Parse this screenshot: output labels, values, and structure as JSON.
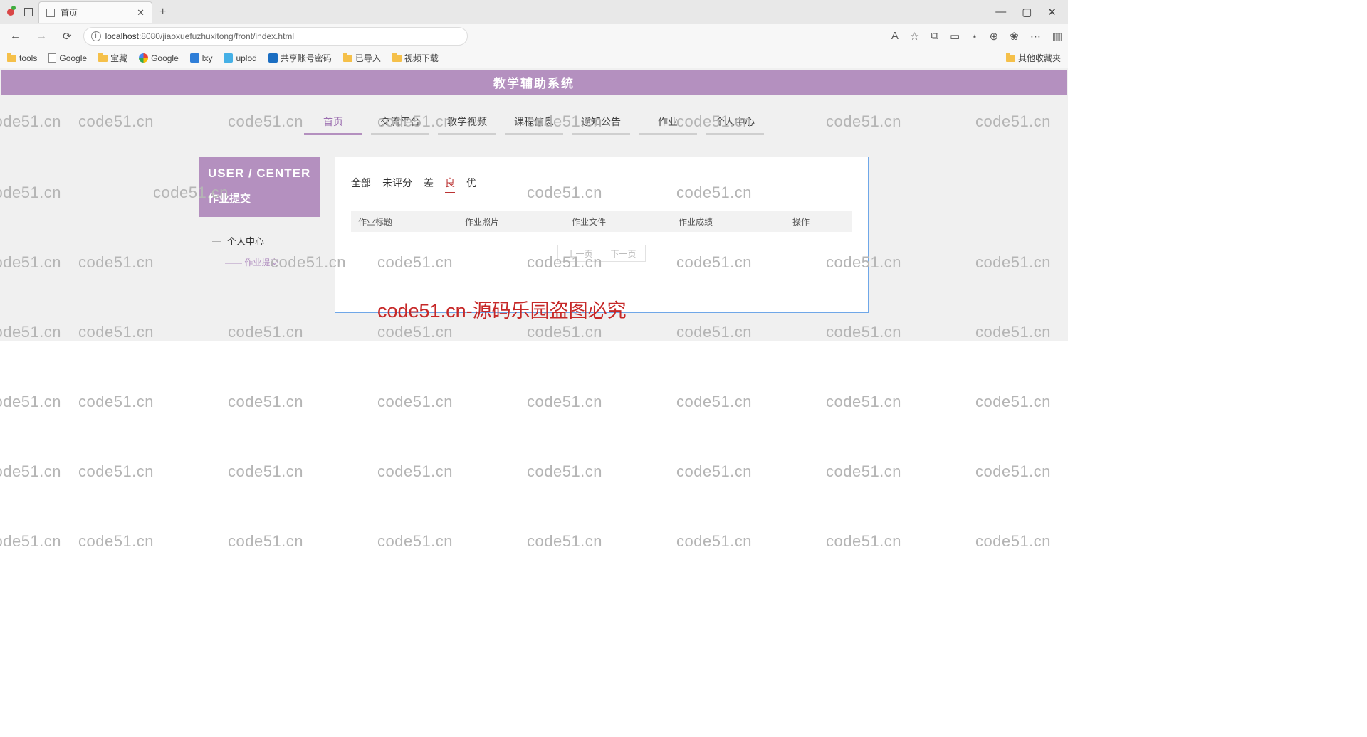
{
  "browser": {
    "tab_title": "首页",
    "url_host": "localhost",
    "url_port": ":8080",
    "url_path": "/jiaoxuefuzhuxitong/front/index.html",
    "new_tab": "+",
    "minimize": "—",
    "maximize": "▢",
    "close": "✕",
    "back": "←",
    "forward": "→",
    "reload": "⟳",
    "info": "i",
    "aa": "A",
    "star": "☆",
    "ext1": "⧉",
    "ext2": "▭",
    "ext3": "⋆",
    "ext4": "⊕",
    "ext5": "❀",
    "more": "⋯",
    "panel": "▥"
  },
  "bookmarks": {
    "b0": "tools",
    "b1": "Google",
    "b2": "宝藏",
    "b3": "Google",
    "b4": "lxy",
    "b5": "uplod",
    "b6": "共享账号密码",
    "b7": "已导入",
    "b8": "视频下载",
    "b_last": "其他收藏夹"
  },
  "page": {
    "banner": "教学辅助系统",
    "nav": {
      "n0": "首页",
      "n1": "交流平台",
      "n2": "教学视频",
      "n3": "课程信息",
      "n4": "通知公告",
      "n5": "作业",
      "n6": "个人中心"
    },
    "sidebar": {
      "title": "USER / CENTER",
      "subtitle": "作业提交",
      "menu1": "个人中心",
      "menu1_sub": "作业提交"
    },
    "filters": {
      "f0": "全部",
      "f1": "未评分",
      "f2": "差",
      "f3": "良",
      "f4": "优"
    },
    "table": {
      "h0": "作业标题",
      "h1": "作业照片",
      "h2": "作业文件",
      "h3": "作业成绩",
      "h4": "操作"
    },
    "pager": {
      "prev": "上一页",
      "next": "下一页"
    }
  },
  "watermark": {
    "text": "code51.cn",
    "center": "code51.cn-源码乐园盗图必究"
  }
}
